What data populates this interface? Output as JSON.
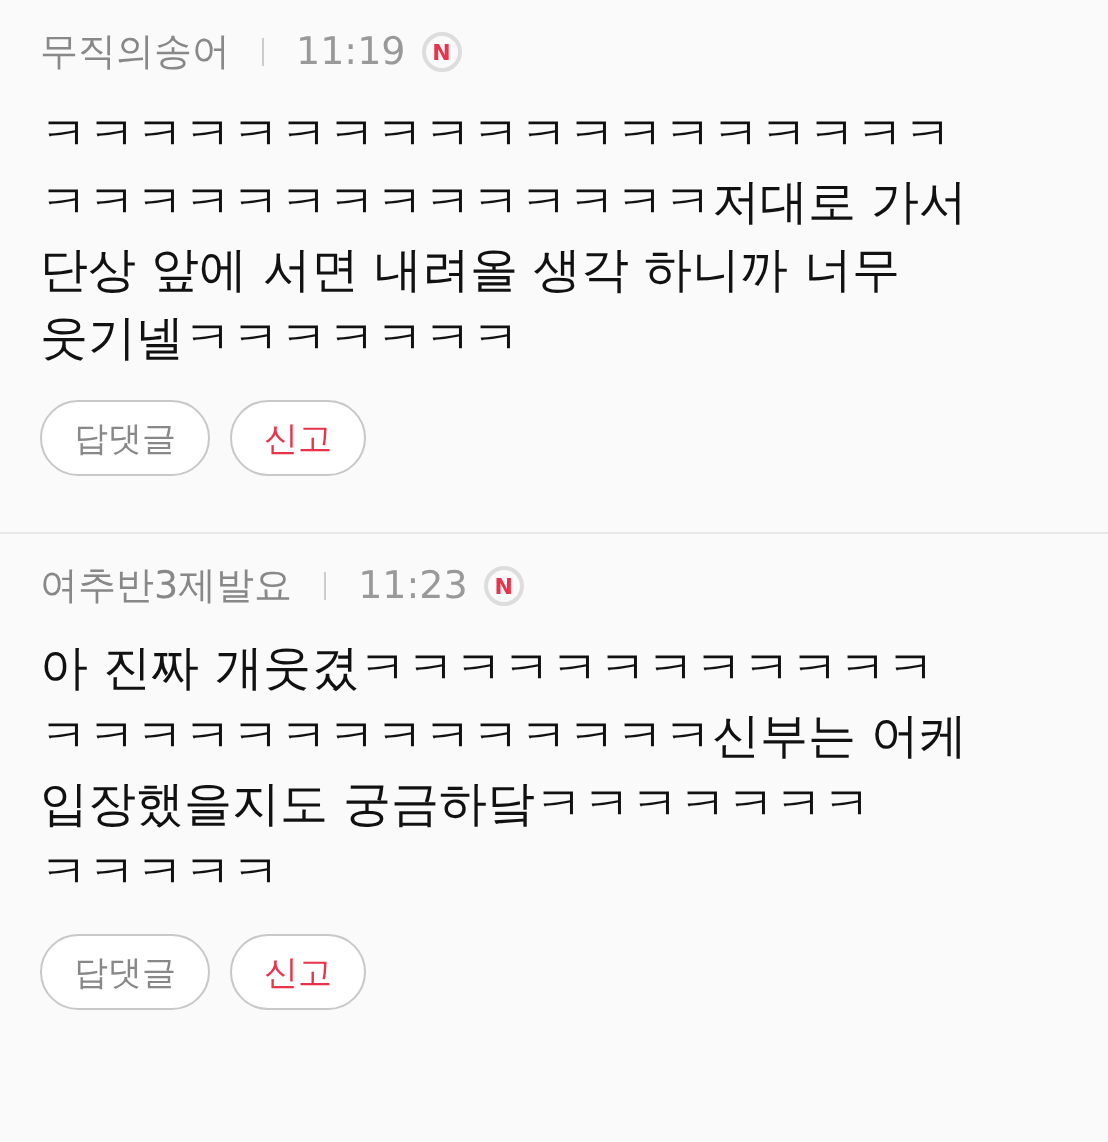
{
  "comments": [
    {
      "author": "무직의송어",
      "time": "11:19",
      "badge": "N",
      "lines": [
        "ㅋㅋㅋㅋㅋㅋㅋㅋㅋㅋㅋㅋㅋㅋㅋㅋㅋㅋㅋ",
        "ㅋㅋㅋㅋㅋㅋㅋㅋㅋㅋㅋㅋㅋㅋ저대로 가서",
        "단상 앞에 서면 내려올 생각 하니까 너무",
        "웃기넬ㅋㅋㅋㅋㅋㅋㅋ"
      ],
      "buttons": [
        {
          "label": "답댓글",
          "kind": "reply"
        },
        {
          "label": "신고",
          "kind": "report"
        }
      ]
    },
    {
      "author": "여추반3제발요",
      "time": "11:23",
      "badge": "N",
      "lines": [
        "아 진짜 개웃겼ㅋㅋㅋㅋㅋㅋㅋㅋㅋㅋㅋㅋ",
        "ㅋㅋㅋㅋㅋㅋㅋㅋㅋㅋㅋㅋㅋㅋ신부는 어케",
        "입장했을지도 궁금하닼ㅋㅋㅋㅋㅋㅋㅋ",
        "ㅋㅋㅋㅋㅋ"
      ],
      "buttons": [
        {
          "label": "답댓글",
          "kind": "reply"
        },
        {
          "label": "신고",
          "kind": "report"
        }
      ]
    }
  ]
}
